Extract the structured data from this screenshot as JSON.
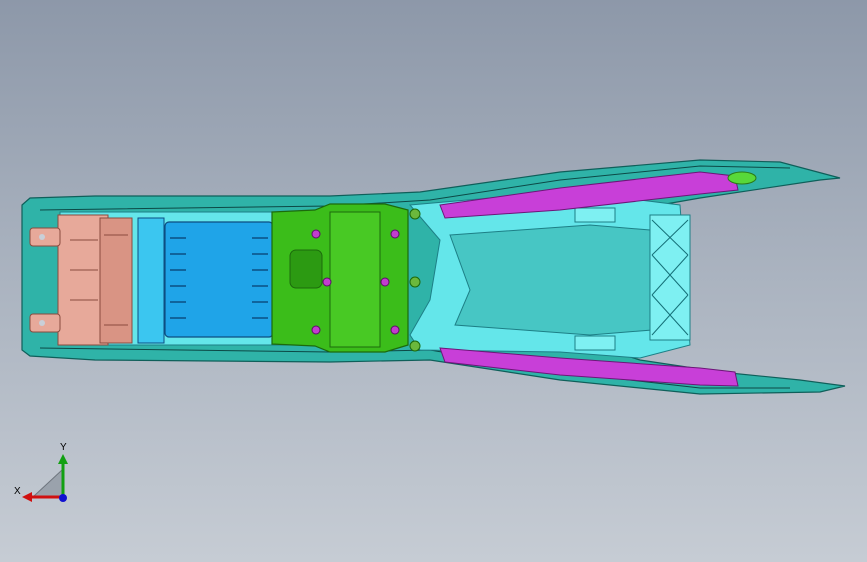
{
  "viewport": {
    "background_top": "#8d98a9",
    "background_bottom": "#c6ccd4"
  },
  "model": {
    "colors": {
      "shell": "#2fb3a8",
      "shell_dark": "#0f5f5a",
      "frame_cyan": "#5ee7ee",
      "bracket_green": "#3bbd1a",
      "bin_blue": "#1fa4e8",
      "latch_salmon": "#e7a99a",
      "strip_magenta": "#c83fd8",
      "fastener_purple": "#b23cc0"
    }
  },
  "triad": {
    "x_label": "X",
    "y_label": "Y",
    "x_color": "#d01010",
    "y_color": "#12a012",
    "z_color": "#1010d0"
  }
}
